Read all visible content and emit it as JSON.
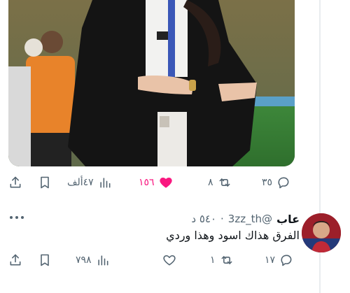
{
  "tweet": {
    "image_alt_icon": "photo",
    "actions": {
      "reply_count": "٣٥",
      "retweet_count": "٨",
      "like_count": "١٥٦",
      "view_count": "٤٧ألف",
      "liked": true
    }
  },
  "reply": {
    "name": "عاب",
    "handle": "@3zz_th",
    "separator": "·",
    "time": "٥٤٠ د",
    "text": "الفرق هذاك اسود وهذا وردي",
    "actions": {
      "reply_count": "١٧",
      "retweet_count": "١",
      "like_count": "",
      "view_count": "٧٩٨"
    }
  },
  "colors": {
    "accent_like": "#f91880",
    "icon_gray": "#536471",
    "text": "#0f1419"
  }
}
